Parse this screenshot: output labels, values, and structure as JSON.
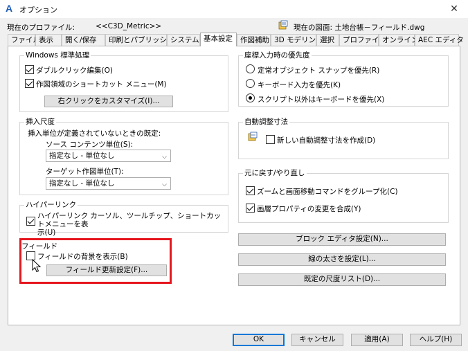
{
  "window": {
    "title": "オプション",
    "close": "✕"
  },
  "profile": {
    "label": "現在のプロファイル:",
    "value": "<<C3D_Metric>>"
  },
  "drawing": {
    "label": "現在の図面:  土地台帳－フィールド.dwg"
  },
  "tabs": [
    {
      "label": "ファイル"
    },
    {
      "label": "表示"
    },
    {
      "label": "開く/保存"
    },
    {
      "label": "印刷とパブリッシュ"
    },
    {
      "label": "システム"
    },
    {
      "label": "基本設定"
    },
    {
      "label": "作図補助"
    },
    {
      "label": "3D モデリング"
    },
    {
      "label": "選択"
    },
    {
      "label": "プロファイル"
    },
    {
      "label": "オンライン"
    },
    {
      "label": "AEC エディタ"
    }
  ],
  "windows_std": {
    "title": "Windows 標準処理",
    "double_click": "ダブルクリック編集(O)",
    "shortcut_menu": "作図領域のショートカット メニュー(M)",
    "customize_button": "右クリックをカスタマイズ(I)..."
  },
  "coord_priority": {
    "title": "座標入力時の優先度",
    "options": [
      {
        "label": "定常オブジェクト スナップを優先(R)"
      },
      {
        "label": "キーボード入力を優先(K)"
      },
      {
        "label": "スクリプト以外はキーボードを優先(X)"
      }
    ]
  },
  "insert_scale": {
    "title": "挿入尺度",
    "subtitle": "挿入単位が定義されていないときの既定:",
    "source_label": "ソース コンテンツ単位(S):",
    "source_value": "指定なし - 単位なし",
    "target_label": "ターゲット作図単位(T):",
    "target_value": "指定なし - 単位なし"
  },
  "assoc_dim": {
    "title": "自動調整寸法",
    "checkbox": "新しい自動調整寸法を作成(D)"
  },
  "undo_redo": {
    "title": "元に戻す/やり直し",
    "zoom_pan": "ズームと画面移動コマンドをグループ化(C)",
    "layer_props": "画層プロパティの変更を合成(Y)"
  },
  "hyperlink": {
    "title": "ハイパーリンク",
    "checkbox_line1": "ハイパーリンク カーソル、ツールチップ、ショートカットメニューを表",
    "checkbox_line2": "示(U)"
  },
  "fields": {
    "title": "フィールド",
    "checkbox": "フィールドの背景を表示(B)",
    "button": "フィールド更新設定(F)..."
  },
  "right_buttons": {
    "block_editor": "ブロック エディタ設定(N)...",
    "lineweight": "線の太さを設定(L)...",
    "scale_list": "既定の尺度リスト(D)..."
  },
  "footer": {
    "ok": "OK",
    "cancel": "キャンセル",
    "apply": "適用(A)",
    "help": "ヘルプ(H)"
  }
}
